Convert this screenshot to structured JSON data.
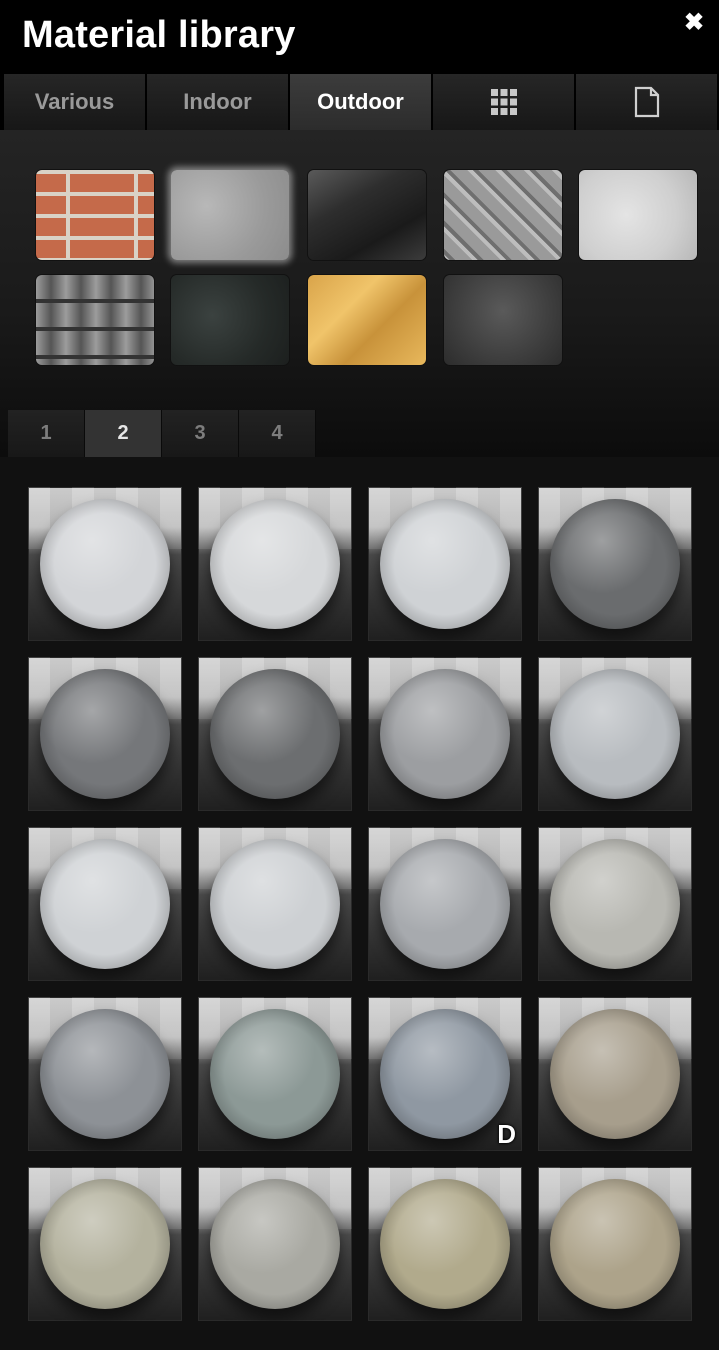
{
  "window": {
    "title": "Material library",
    "close_glyph": "✖"
  },
  "tabs": [
    {
      "label": "Various",
      "active": false
    },
    {
      "label": "Indoor",
      "active": false
    },
    {
      "label": "Outdoor",
      "active": true
    },
    {
      "icon": "grid-icon",
      "active": false
    },
    {
      "icon": "document-icon",
      "active": false
    }
  ],
  "swatches": [
    {
      "name": "brick",
      "selected": false
    },
    {
      "name": "concrete",
      "selected": true
    },
    {
      "name": "glass",
      "selected": false
    },
    {
      "name": "diamond-plate-metal",
      "selected": false
    },
    {
      "name": "plaster",
      "selected": false
    },
    {
      "name": "roof-tiles",
      "selected": false
    },
    {
      "name": "granite",
      "selected": false
    },
    {
      "name": "osb-wood",
      "selected": false
    },
    {
      "name": "asphalt",
      "selected": false
    }
  ],
  "pages": [
    {
      "label": "1",
      "active": false
    },
    {
      "label": "2",
      "active": true
    },
    {
      "label": "3",
      "active": false
    },
    {
      "label": "4",
      "active": false
    }
  ],
  "materials": [
    {
      "color": "#d3d5d8",
      "badge": ""
    },
    {
      "color": "#d6d8da",
      "badge": ""
    },
    {
      "color": "#cfd2d5",
      "badge": ""
    },
    {
      "color": "#6a6c6e",
      "badge": ""
    },
    {
      "color": "#75777a",
      "badge": ""
    },
    {
      "color": "#6c6e70",
      "badge": ""
    },
    {
      "color": "#9c9ea1",
      "badge": ""
    },
    {
      "color": "#b8bcc0",
      "badge": ""
    },
    {
      "color": "#cfd2d5",
      "badge": ""
    },
    {
      "color": "#cdd0d3",
      "badge": ""
    },
    {
      "color": "#a7aaae",
      "badge": ""
    },
    {
      "color": "#b8b8b2",
      "badge": ""
    },
    {
      "color": "#8d9196",
      "badge": ""
    },
    {
      "color": "#8c9996",
      "badge": ""
    },
    {
      "color": "#8f98a2",
      "badge": "D"
    },
    {
      "color": "#a79e8c",
      "badge": ""
    },
    {
      "color": "#b4b29e",
      "badge": ""
    },
    {
      "color": "#a9a9a2",
      "badge": ""
    },
    {
      "color": "#b1aa8c",
      "badge": ""
    },
    {
      "color": "#ada38a",
      "badge": ""
    }
  ]
}
